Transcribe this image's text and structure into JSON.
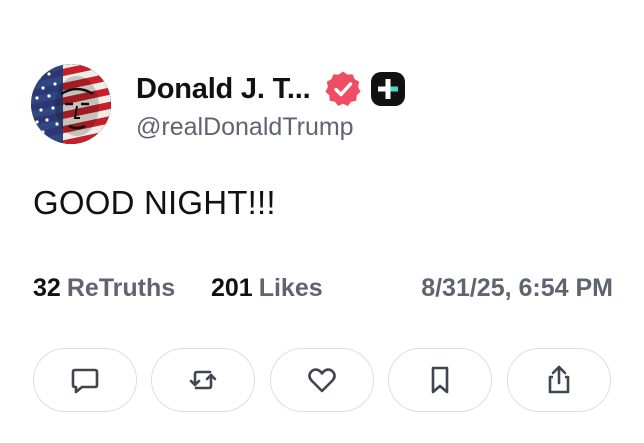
{
  "author": {
    "display_name": "Donald J. T...",
    "handle": "@realDonaldTrump",
    "verified": true
  },
  "post": {
    "text": "GOOD NIGHT!!!"
  },
  "stats": {
    "retruths_count": "32",
    "retruths_label": "ReTruths",
    "likes_count": "201",
    "likes_label": "Likes",
    "timestamp": "8/31/25, 6:54 PM"
  },
  "actions": [
    {
      "icon": "reply-icon"
    },
    {
      "icon": "retruth-icon"
    },
    {
      "icon": "like-icon"
    },
    {
      "icon": "bookmark-icon"
    },
    {
      "icon": "share-icon"
    }
  ],
  "colors": {
    "verified_badge": "#ef4d63",
    "plus_badge": "#111111",
    "muted_text": "#5f6570",
    "button_border": "#dcdfe5"
  }
}
